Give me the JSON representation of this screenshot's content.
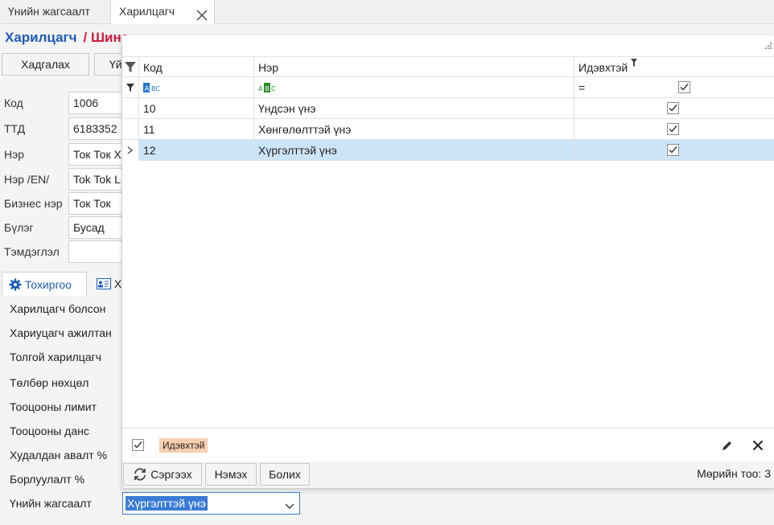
{
  "tabs": [
    {
      "label": "Үнийн жагсаалт"
    },
    {
      "label": "Харилцагч"
    }
  ],
  "breadcrumb": {
    "section": "Харилцагч",
    "current": "/ Шинэ"
  },
  "toolbar": {
    "save_label": "Хадгалах",
    "second_label": "Үй"
  },
  "form": {
    "code": {
      "label": "Код",
      "value": "1006"
    },
    "ttd": {
      "label": "ТТД",
      "value": "6183352"
    },
    "name": {
      "label": "Нэр",
      "value": "Ток Ток Х"
    },
    "name_en": {
      "label": "Нэр /EN/",
      "value": "Tok Tok L"
    },
    "business_name": {
      "label": "Бизнес нэр",
      "value": "Ток Ток"
    },
    "group": {
      "label": "Бүлэг",
      "value": "Бусад"
    },
    "note": {
      "label": "Тэмдэглэл",
      "value": ""
    }
  },
  "lower_tabs": {
    "settings": "Тохиргоо",
    "other": "Х"
  },
  "settings": [
    "Харилцагч болсон",
    "Хариуцагч ажилтан",
    "Толгой харилцагч",
    "Төлбөр нөхцөл",
    "Тооцооны лимит",
    "Тооцооны данс",
    "Худалдан авалт %",
    "Борлуулалт %",
    "Үнийн жагсаалт"
  ],
  "popup": {
    "columns": {
      "code": "Код",
      "name": "Нэр",
      "active": "Идэвхтэй"
    },
    "filter_row": {
      "active_operator": "="
    },
    "rows": [
      {
        "code": "10",
        "name": "Үндсэн үнэ",
        "active": true
      },
      {
        "code": "11",
        "name": "Хөнгөлөлттэй үнэ",
        "active": true
      },
      {
        "code": "12",
        "name": "Хүргэлттэй үнэ",
        "active": true
      }
    ],
    "filter_tag": "Идэвхтэй",
    "buttons": {
      "refresh": "Сэргээх",
      "add": "Нэмэх",
      "cancel": "Болих"
    },
    "count_label": "Мөрийн тоо: 3"
  },
  "price_list_value": "Хүргэлттэй үнэ",
  "colors": {
    "accent": "#1e5bb8",
    "breadcrumb_red": "#d21c3c",
    "selection": "#cce4f7",
    "tag": "#f9cfb0"
  }
}
